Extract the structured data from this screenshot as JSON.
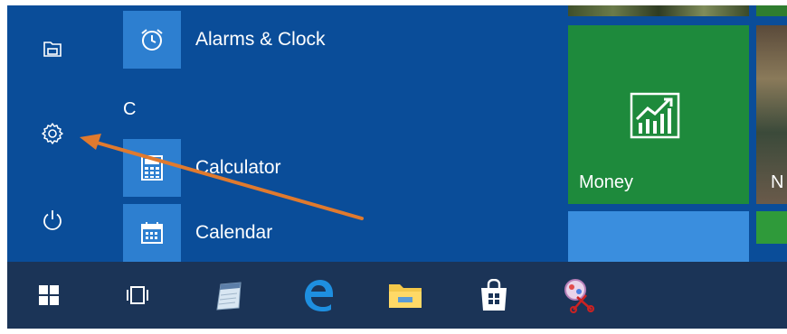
{
  "start_menu": {
    "section_letter": "C",
    "apps": [
      {
        "label": "Alarms & Clock",
        "icon": "alarm-clock-icon"
      },
      {
        "label": "Calculator",
        "icon": "calculator-icon"
      },
      {
        "label": "Calendar",
        "icon": "calendar-icon"
      }
    ],
    "rail": [
      {
        "icon": "file-explorer-icon"
      },
      {
        "icon": "settings-gear-icon"
      },
      {
        "icon": "power-icon"
      }
    ]
  },
  "tiles": {
    "money_label": "Money",
    "partial_label": "N"
  },
  "taskbar": {
    "items": [
      "start-windows-icon",
      "task-view-icon",
      "notepad-icon",
      "edge-icon",
      "file-explorer-folder-icon",
      "store-icon",
      "snipping-tool-icon"
    ]
  },
  "colors": {
    "accent_blue": "#0a4d99",
    "tile_blue": "#2d7fd0",
    "money_green": "#1e8a3c",
    "taskbar": "#1b3457",
    "annotation_arrow": "#e07a2e"
  }
}
